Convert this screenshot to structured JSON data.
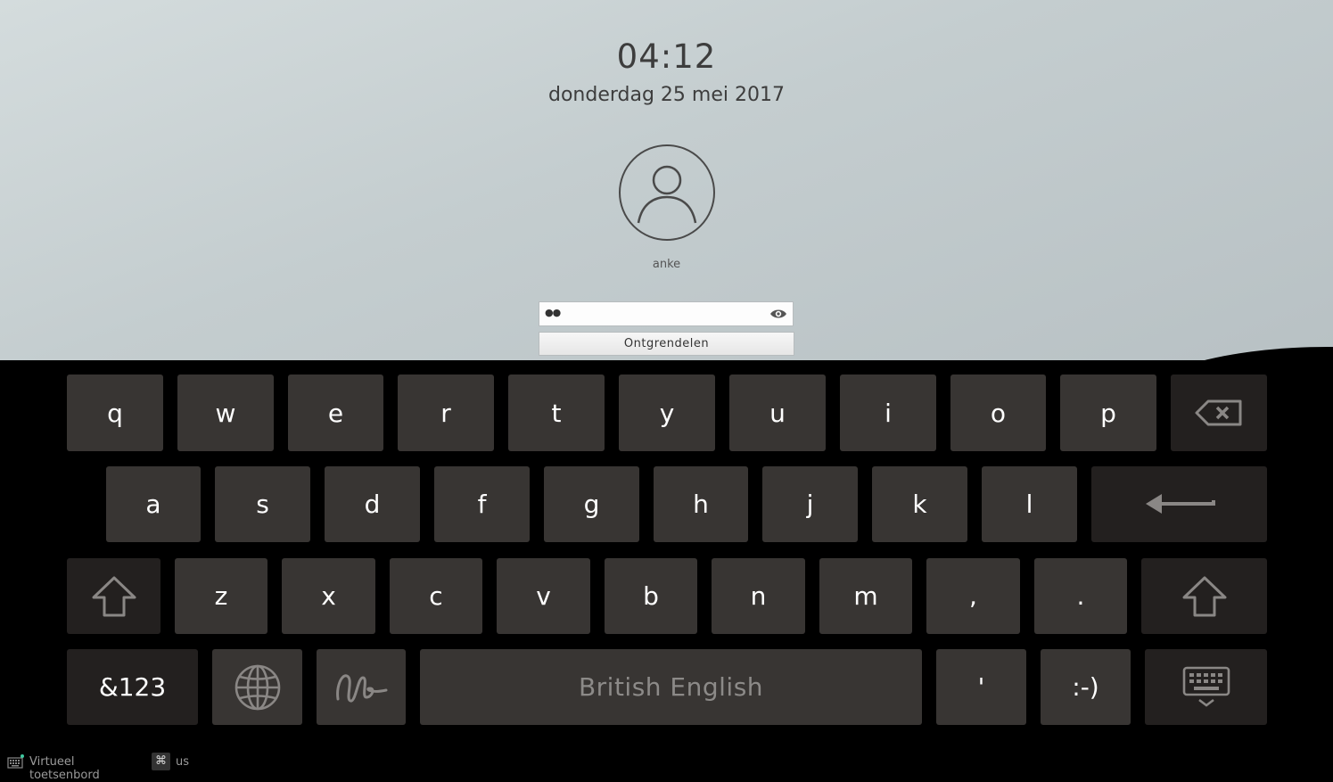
{
  "lockscreen": {
    "time": "04:12",
    "date": "donderdag 25 mei 2017",
    "username": "anke",
    "password_masked": "●●",
    "unlock_label": "Ontgrendelen",
    "icons": {
      "avatar": "user-avatar-icon",
      "reveal": "eye-icon"
    }
  },
  "keyboard": {
    "row1": [
      "q",
      "w",
      "e",
      "r",
      "t",
      "y",
      "u",
      "i",
      "o",
      "p"
    ],
    "row2": [
      "a",
      "s",
      "d",
      "f",
      "g",
      "h",
      "j",
      "k",
      "l"
    ],
    "row3": [
      "z",
      "x",
      "c",
      "v",
      "b",
      "n",
      "m",
      ",",
      "."
    ],
    "symbols_label": "&123",
    "space_label": "British English",
    "apostrophe": "'",
    "smiley": ":-)",
    "icons": {
      "backspace": "backspace-icon",
      "enter": "enter-icon",
      "shift": "shift-icon",
      "language": "globe-icon",
      "handwriting": "handwriting-icon",
      "hide": "hide-keyboard-icon"
    }
  },
  "statusbar": {
    "virtual_keyboard_label": "Virtueel toetsenbord",
    "layout_label": "us",
    "icons": {
      "keyboard": "keyboard-icon",
      "layout": "command-icon"
    }
  }
}
